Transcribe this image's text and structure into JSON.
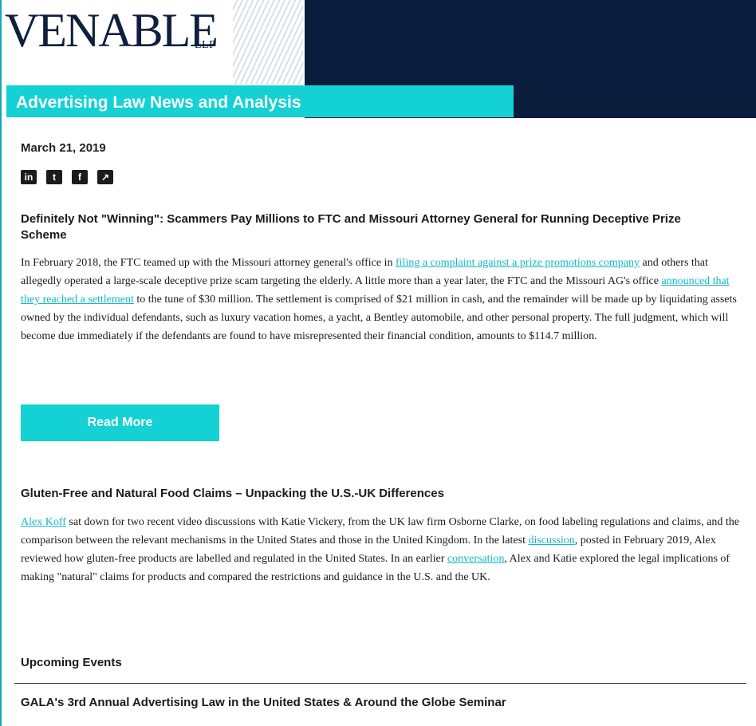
{
  "header": {
    "logo": "VENABLE",
    "logo_suffix": "LLP",
    "banner_title": "Advertising Law News and Analysis"
  },
  "date": "March 21, 2019",
  "social": [
    {
      "icon": "linkedin-icon",
      "glyph": "in"
    },
    {
      "icon": "twitter-icon",
      "glyph": "t"
    },
    {
      "icon": "facebook-icon",
      "glyph": "f"
    },
    {
      "icon": "share-icon",
      "glyph": "↗"
    }
  ],
  "article1": {
    "title": "Definitely Not \"Winning\": Scammers Pay Millions to FTC and Missouri Attorney General for Running Deceptive Prize Scheme",
    "p_a": "In February 2018, the FTC teamed up with the Missouri attorney general's office in ",
    "link1": "filing a complaint against a prize promotions company",
    "p_b": " and others that allegedly operated a large-scale deceptive prize scam targeting the elderly. A little more than a year later, the FTC and the Missouri AG's office ",
    "link2": "announced that they reached a settlement",
    "p_c": " to the tune of $30 million. The settlement is comprised of $21 million in cash, and the remainder will be made up by liquidating assets owned by the individual defendants, such as luxury vacation homes, a yacht, a Bentley automobile, and other personal property. The full judgment, which will become due immediately if the defendants are found to have misrepresented their financial condition, amounts to $114.7 million.",
    "read_more": "Read More"
  },
  "article2": {
    "title": "Gluten-Free and Natural Food Claims – Unpacking the U.S.-UK Differences",
    "link1": "Alex Koff",
    "p_a": " sat down for two recent video discussions with Katie Vickery, from the UK law firm Osborne Clarke, on food labeling regulations and claims, and the comparison between the relevant mechanisms in the United States and those in the United Kingdom. In the latest ",
    "link2": "discussion",
    "p_b": ", posted in February 2019, Alex reviewed how gluten-free products are labelled and regulated in the United States. In an earlier ",
    "link3": "conversation",
    "p_c": ", Alex and Katie explored the legal implications of making \"natural\" claims for products and compared the restrictions and guidance in the U.S. and the UK."
  },
  "events": {
    "heading": "Upcoming Events",
    "item1": "GALA's 3rd Annual Advertising Law in the United States & Around the Globe Seminar"
  },
  "colors": {
    "teal": "#14d1d4",
    "navy": "#0b1d3c",
    "link": "#14b8c4"
  }
}
